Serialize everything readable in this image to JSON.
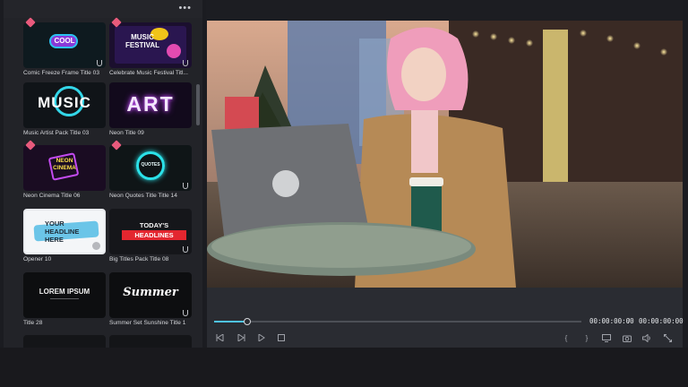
{
  "panel": {
    "more_label": "•••",
    "items": [
      {
        "caption": "Comic Freeze Frame Title 03",
        "thumb_text": "COOL",
        "premium": true
      },
      {
        "caption": "Celebrate Music Festival Titl...",
        "thumb_text": "MUSIC FESTIVAL",
        "premium": true
      },
      {
        "caption": "Music Artist Pack Title 03",
        "thumb_text": "MUSIC",
        "premium": false
      },
      {
        "caption": "Neon Title 09",
        "thumb_text": "ART",
        "premium": false
      },
      {
        "caption": "Neon Cinema Title 06",
        "thumb_text": "NEON CINEMA",
        "premium": true
      },
      {
        "caption": "Neon Quotes Title Title 14",
        "thumb_text": "QUOTES",
        "premium": true
      },
      {
        "caption": "Opener 10",
        "thumb_text": "YOUR HEADLINE HERE",
        "premium": false
      },
      {
        "caption": "Big Titles Pack Title 08",
        "thumb_text_line1": "TODAY'S",
        "thumb_text_line2": "HEADLINES",
        "premium": false
      },
      {
        "caption": "Title 28",
        "thumb_text": "LOREM IPSUM",
        "premium": false
      },
      {
        "caption": "Summer Set Sunshine Title 1",
        "thumb_text": "Summer",
        "premium": false
      }
    ]
  },
  "player": {
    "current_time": "00:00:00:00",
    "separator": "/",
    "total_time": "00:00:00:00",
    "progress_fraction": 0.09
  },
  "colors": {
    "accent": "#4fc3e8",
    "premium": "#e85a7c"
  }
}
